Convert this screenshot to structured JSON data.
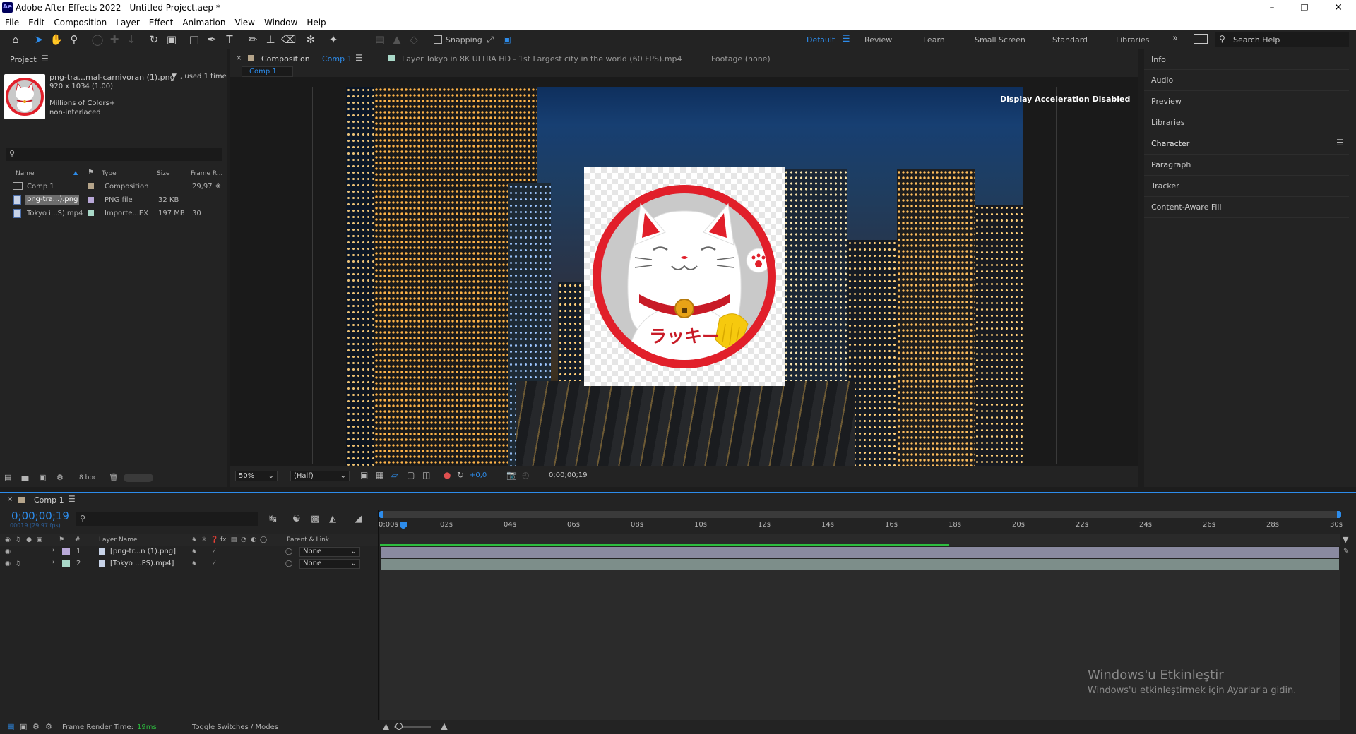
{
  "window": {
    "title": "Adobe After Effects 2022 - Untitled Project.aep *",
    "app_logo": "Ae"
  },
  "menu": [
    "File",
    "Edit",
    "Composition",
    "Layer",
    "Effect",
    "Animation",
    "View",
    "Window",
    "Help"
  ],
  "toolbar": {
    "snapping_label": "Snapping",
    "search_help_placeholder": "Search Help"
  },
  "workspaces": [
    "Default",
    "Review",
    "Learn",
    "Small Screen",
    "Standard",
    "Libraries"
  ],
  "active_workspace": "Default",
  "project": {
    "title": "Project",
    "selected_file": {
      "name": "png-tra...mal-carnivoran (1).png",
      "used": ", used 1 time",
      "dimensions": "920 x 1034 (1,00)",
      "colors": "Millions of Colors+",
      "interlace": "non-interlaced"
    },
    "search_placeholder": "",
    "columns": [
      "Name",
      "Type",
      "Size",
      "Frame R..."
    ],
    "items": [
      {
        "name": "Comp 1",
        "type": "Composition",
        "size": "",
        "frame_rate": "29,97",
        "color": "#b5a48a"
      },
      {
        "name": "png-tra...).png",
        "type": "PNG file",
        "size": "32 KB",
        "frame_rate": "",
        "color": "#b9a8d8"
      },
      {
        "name": "Tokyo i...S).mp4",
        "type": "Importe...EX",
        "size": "197 MB",
        "frame_rate": "30",
        "color": "#a9d8c8"
      }
    ],
    "bpc": "8 bpc"
  },
  "comp_panel": {
    "tab_prefix": "Composition",
    "tab_name": "Comp 1",
    "layer_tab": "Layer  Tokyo in 8K ULTRA HD - 1st Largest city in the world (60 FPS).mp4",
    "footage_tab": "Footage  (none)",
    "sub_tab": "Comp 1",
    "overlay_text": "Display Acceleration Disabled",
    "stamp_text": "ラッキー",
    "zoom": "50%",
    "resolution": "(Half)",
    "exposure": "+0,0",
    "timecode": "0;00;00;19"
  },
  "right_panels": [
    "Info",
    "Audio",
    "Preview",
    "Libraries",
    "Character",
    "Paragraph",
    "Tracker",
    "Content-Aware Fill"
  ],
  "timeline": {
    "comp_name": "Comp 1",
    "timecode": "0;00;00;19",
    "frame_info": "00019 (29.97 fps)",
    "columns": {
      "num": "#",
      "layer_name": "Layer Name",
      "parent": "Parent & Link"
    },
    "ruler": [
      "0:00s",
      "02s",
      "04s",
      "06s",
      "08s",
      "10s",
      "12s",
      "14s",
      "16s",
      "18s",
      "20s",
      "22s",
      "24s",
      "26s",
      "28s",
      "30s"
    ],
    "layers": [
      {
        "num": "1",
        "name": "[png-tr...n (1).png]",
        "parent": "None",
        "color": "#b9a8d8"
      },
      {
        "num": "2",
        "name": "[Tokyo ...PS).mp4]",
        "parent": "None",
        "color": "#a9d8c8"
      }
    ],
    "render_label": "Frame Render Time:",
    "render_value": "19ms",
    "toggle_label": "Toggle Switches / Modes"
  },
  "watermark": {
    "title": "Windows'u Etkinleştir",
    "subtitle": "Windows'u etkinleştirmek için Ayarlar'a gidin."
  }
}
